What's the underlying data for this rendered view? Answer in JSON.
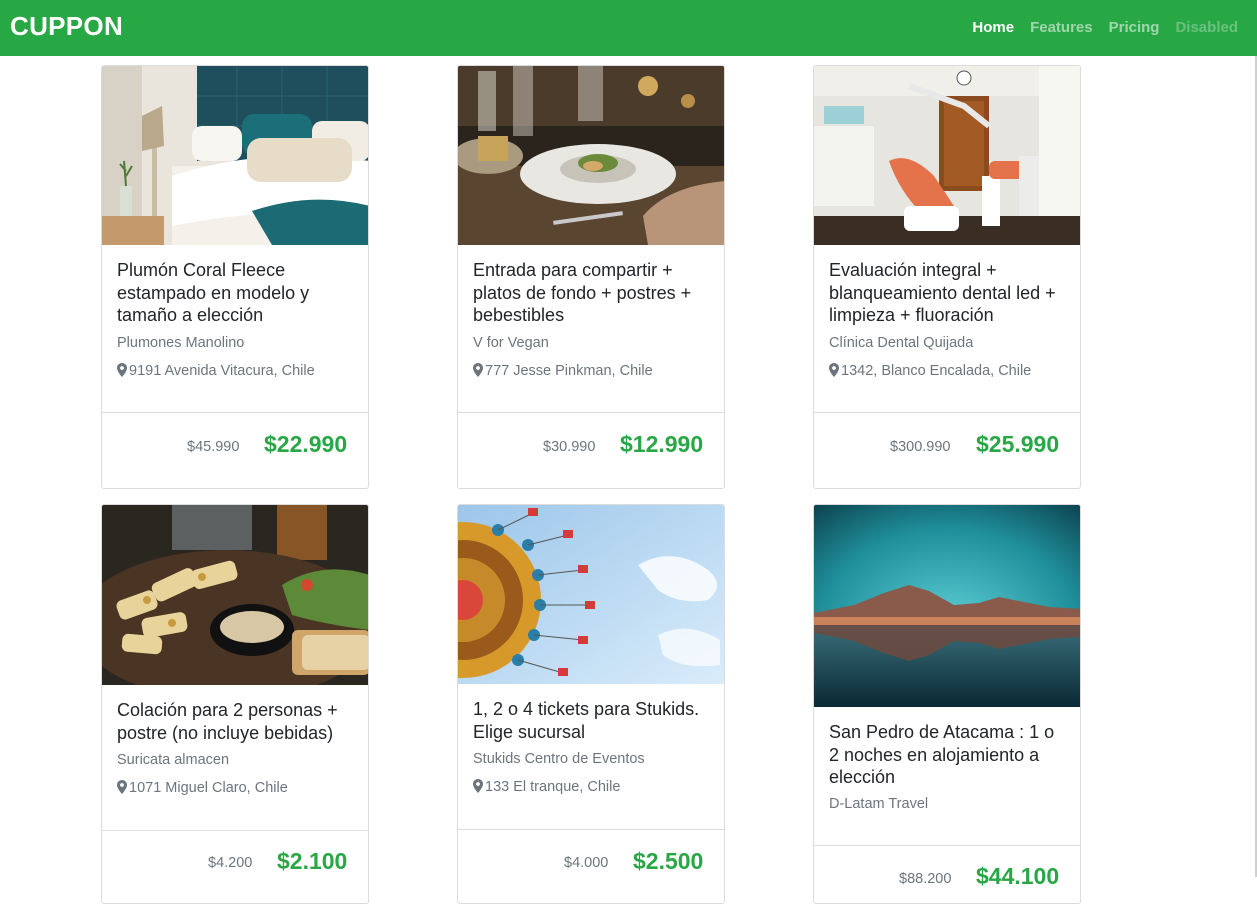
{
  "header": {
    "brand": "CUPPON",
    "nav": [
      {
        "label": "Home"
      },
      {
        "label": "Features"
      },
      {
        "label": "Pricing"
      },
      {
        "label": "Disabled"
      }
    ]
  },
  "icons": {
    "location": "map-marker-icon"
  },
  "colors": {
    "accent": "#28a745",
    "muted": "#6c757d"
  },
  "deals": [
    {
      "title": "Plumón Coral Fleece estampado en modelo y tamaño a elección",
      "merchant": "Plumones Manolino",
      "address": "9191 Avenida Vitacura, Chile",
      "old_price": "$45.990",
      "new_price": "$22.990"
    },
    {
      "title": "Entrada para compartir + platos de fondo + postres + bebestibles",
      "merchant": "V for Vegan",
      "address": "777 Jesse Pinkman, Chile",
      "old_price": "$30.990",
      "new_price": "$12.990"
    },
    {
      "title": "Evaluación integral + blanqueamiento dental led + limpieza + fluoración",
      "merchant": "Clínica Dental Quijada",
      "address": "1342, Blanco Encalada, Chile",
      "old_price": "$300.990",
      "new_price": "$25.990"
    },
    {
      "title": "Colación para 2 personas + postre (no incluye bebidas)",
      "merchant": "Suricata almacen",
      "address": "1071 Miguel Claro, Chile",
      "old_price": "$4.200",
      "new_price": "$2.100"
    },
    {
      "title": "1, 2 o 4 tickets para Stukids. Elige sucursal",
      "merchant": "Stukids Centro de Eventos",
      "address": "133 El tranque, Chile",
      "old_price": "$4.000",
      "new_price": "$2.500"
    },
    {
      "title": "San Pedro de Atacama : 1 o 2 noches en alojamiento a elección",
      "merchant": "D-Latam Travel",
      "old_price": "$88.200",
      "new_price": "$44.100"
    }
  ]
}
